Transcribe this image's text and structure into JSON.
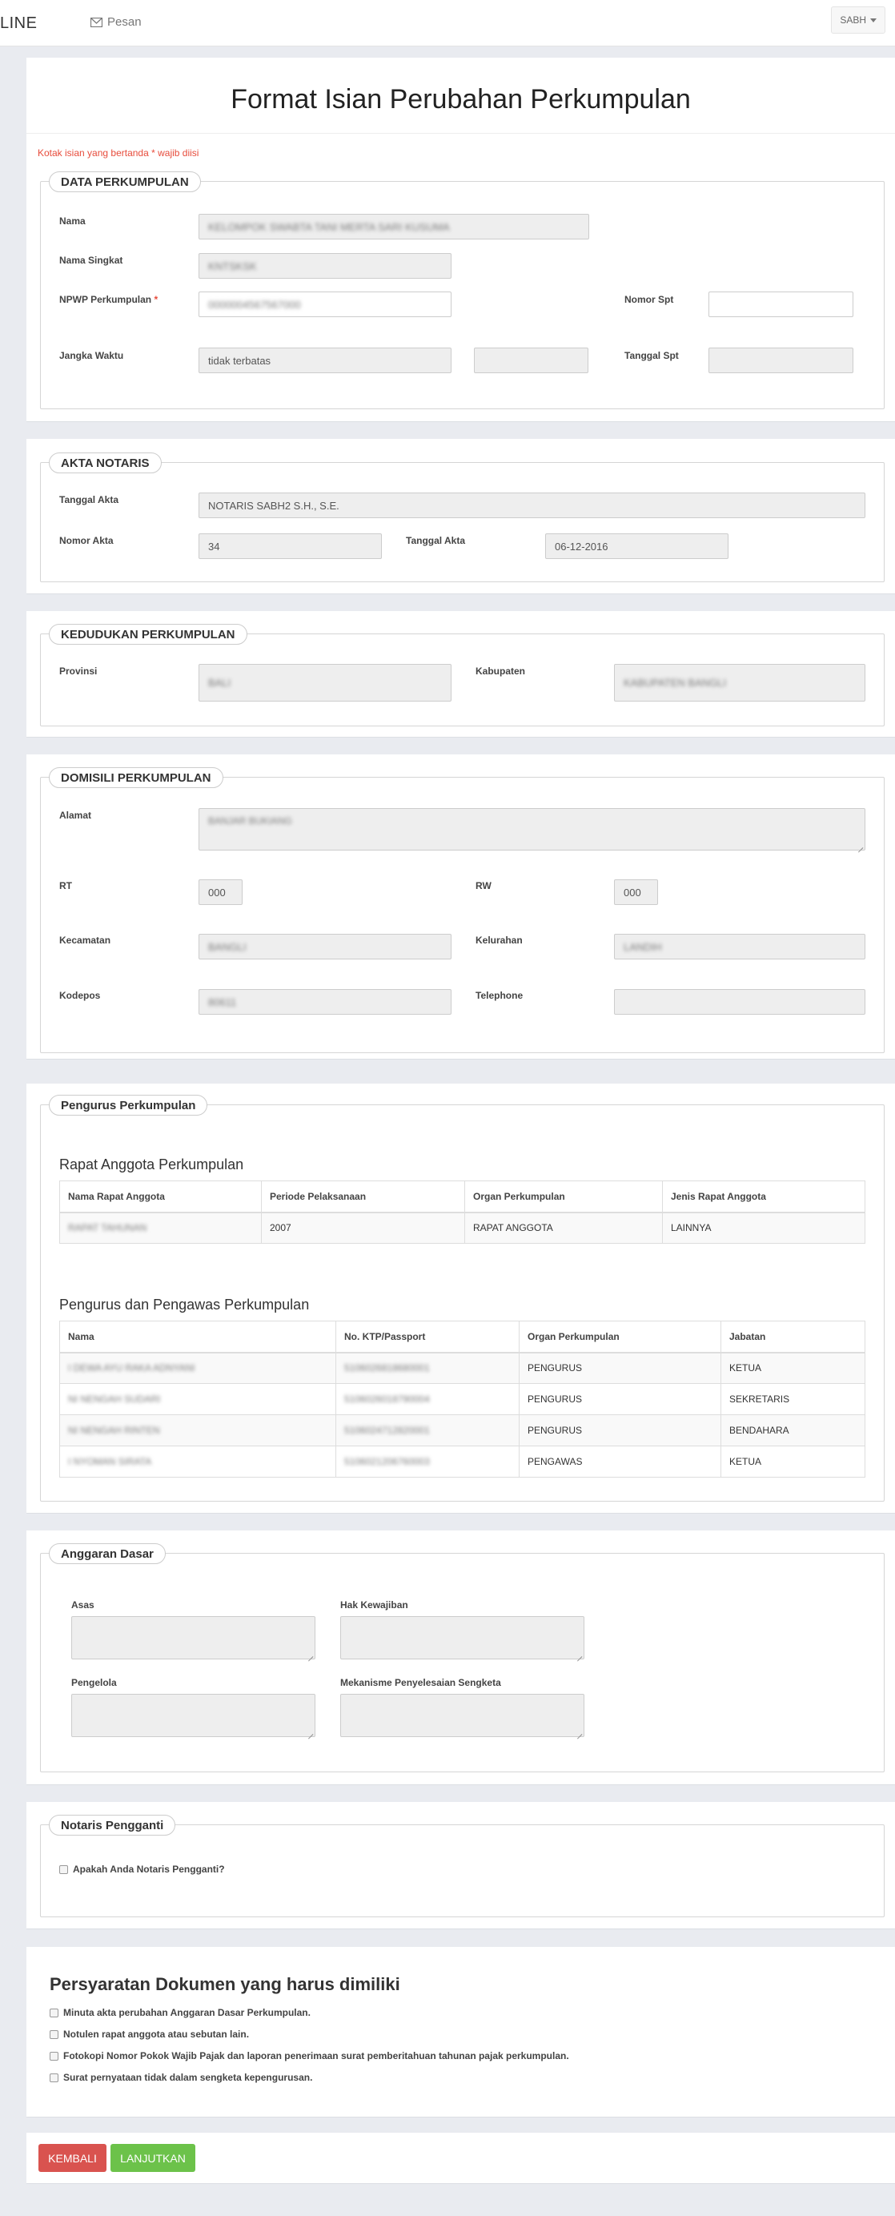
{
  "header": {
    "brand": "LINE",
    "messages_label": "Pesan",
    "user_label": "SABH"
  },
  "form": {
    "title": "Format Isian Perubahan Perkumpulan",
    "required_note": "Kotak isian yang bertanda * wajib diisi",
    "required_mark": "*"
  },
  "data_perkumpulan": {
    "legend": "DATA PERKUMPULAN",
    "nama_label": "Nama",
    "nama_value": "KELOMPOK SWABTA TANI MERTA SARI KUSUMA",
    "nama_singkat_label": "Nama Singkat",
    "nama_singkat_value": "KNTSKSK",
    "npwp_label": "NPWP Perkumpulan",
    "npwp_value": "0000004567567000",
    "nomor_spt_label": "Nomor Spt",
    "nomor_spt_value": "",
    "jangka_waktu_label": "Jangka Waktu",
    "jangka_waktu_value": "tidak terbatas",
    "jangka_waktu_extra": "",
    "tanggal_spt_label": "Tanggal Spt",
    "tanggal_spt_value": ""
  },
  "akta_notaris": {
    "legend": "AKTA NOTARIS",
    "tanggal_akta_label": "Tanggal Akta",
    "notaris_value": "NOTARIS SABH2 S.H., S.E.",
    "nomor_akta_label": "Nomor Akta",
    "nomor_akta_value": "34",
    "tanggal_akta2_label": "Tanggal Akta",
    "tanggal_akta_value": "06-12-2016"
  },
  "kedudukan": {
    "legend": "KEDUDUKAN PERKUMPULAN",
    "provinsi_label": "Provinsi",
    "provinsi_value": "BALI",
    "kabupaten_label": "Kabupaten",
    "kabupaten_value": "KABUPATEN BANGLI"
  },
  "domisili": {
    "legend": "DOMISILI PERKUMPULAN",
    "alamat_label": "Alamat",
    "alamat_value": "BANJAR BUKIANG",
    "rt_label": "RT",
    "rt_value": "000",
    "rw_label": "RW",
    "rw_value": "000",
    "kecamatan_label": "Kecamatan",
    "kecamatan_value": "BANGLI",
    "kelurahan_label": "Kelurahan",
    "kelurahan_value": "LANDIH",
    "kodepos_label": "Kodepos",
    "kodepos_value": "80611",
    "telephone_label": "Telephone",
    "telephone_value": ""
  },
  "pengurus": {
    "legend": "Pengurus Perkumpulan",
    "rapat_title": "Rapat Anggota Perkumpulan",
    "rapat_headers": [
      "Nama Rapat Anggota",
      "Periode Pelaksanaan",
      "Organ Perkumpulan",
      "Jenis Rapat Anggota"
    ],
    "rapat_rows": [
      {
        "nama": "RAPAT TAHUNAN",
        "periode": "2007",
        "organ": "RAPAT ANGGOTA",
        "jenis": "LAINNYA"
      }
    ],
    "pengurus_title": "Pengurus dan Pengawas Perkumpulan",
    "pengurus_headers": [
      "Nama",
      "No. KTP/Passport",
      "Organ Perkumpulan",
      "Jabatan"
    ],
    "pengurus_rows": [
      {
        "nama": "I DEWA AYU RAKA ADNYANI",
        "ktp": "5106026818680001",
        "organ": "PENGURUS",
        "jabatan": "KETUA"
      },
      {
        "nama": "NI NENGAH SUDARI",
        "ktp": "5106026018790004",
        "organ": "PENGURUS",
        "jabatan": "SEKRETARIS"
      },
      {
        "nama": "NI NENGAH RINTEN",
        "ktp": "5106024712820001",
        "organ": "PENGURUS",
        "jabatan": "BENDAHARA"
      },
      {
        "nama": "I NYOMAN SIRATA",
        "ktp": "5106021206760003",
        "organ": "PENGAWAS",
        "jabatan": "KETUA"
      }
    ]
  },
  "anggaran": {
    "legend": "Anggaran Dasar",
    "asas_label": "Asas",
    "hak_label": "Hak Kewajiban",
    "pengelola_label": "Pengelola",
    "mekanisme_label": "Mekanisme Penyelesaian Sengketa"
  },
  "notaris_pengganti": {
    "legend": "Notaris Pengganti",
    "question": "Apakah Anda Notaris Pengganti?"
  },
  "persyaratan": {
    "title": "Persyaratan Dokumen yang harus dimiliki",
    "items": [
      "Minuta akta perubahan Anggaran Dasar Perkumpulan.",
      "Notulen rapat anggota atau sebutan lain.",
      "Fotokopi Nomor Pokok Wajib Pajak dan laporan penerimaan surat pemberitahuan tahunan pajak perkumpulan.",
      "Surat pernyataan tidak dalam sengketa kepengurusan."
    ]
  },
  "actions": {
    "back_label": "KEMBALI",
    "next_label": "LANJUTKAN",
    "back_color": "#d9534f",
    "next_color": "#6cc24a"
  }
}
